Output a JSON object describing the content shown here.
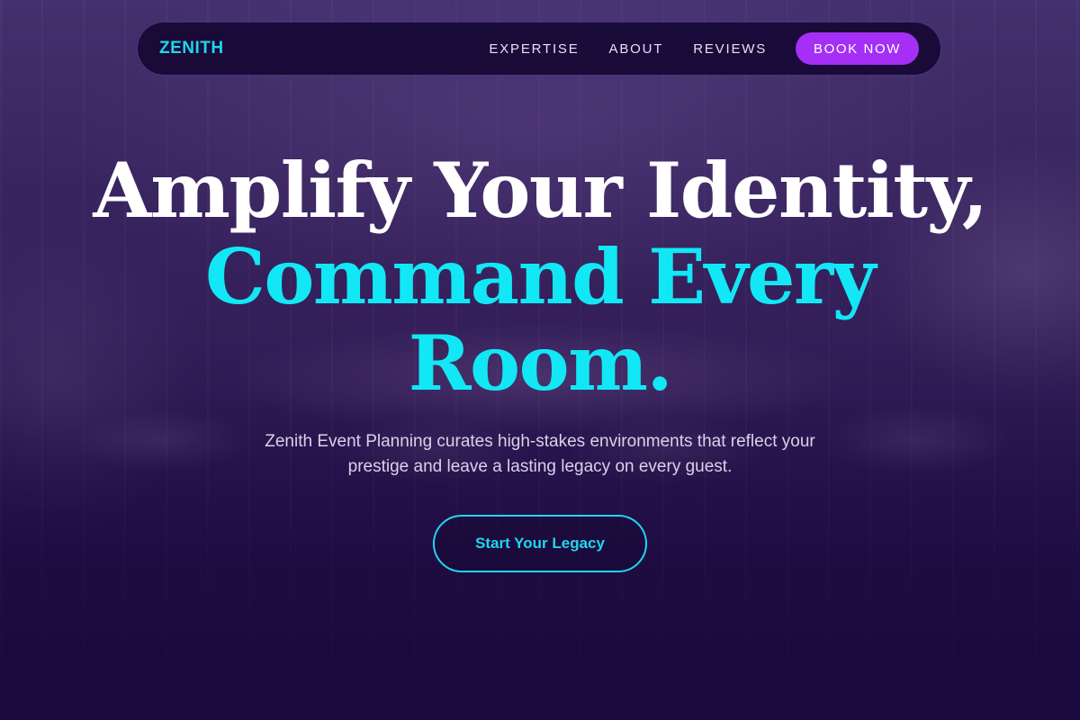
{
  "nav": {
    "brand": "ZENITH",
    "links": [
      "EXPERTISE",
      "ABOUT",
      "REVIEWS"
    ],
    "book_label": "BOOK NOW"
  },
  "hero": {
    "headline_line1": "Amplify Your Identity,",
    "headline_line2": "Command Every",
    "headline_line3": "Room.",
    "subtext": "Zenith Event Planning curates high-stakes environments that reflect your prestige and leave a lasting legacy on every guest.",
    "cta_label": "Start Your Legacy"
  },
  "colors": {
    "accent_cyan": "#12e8f5",
    "accent_purple": "#a52ff5",
    "background_deep": "#1c0a3e"
  }
}
